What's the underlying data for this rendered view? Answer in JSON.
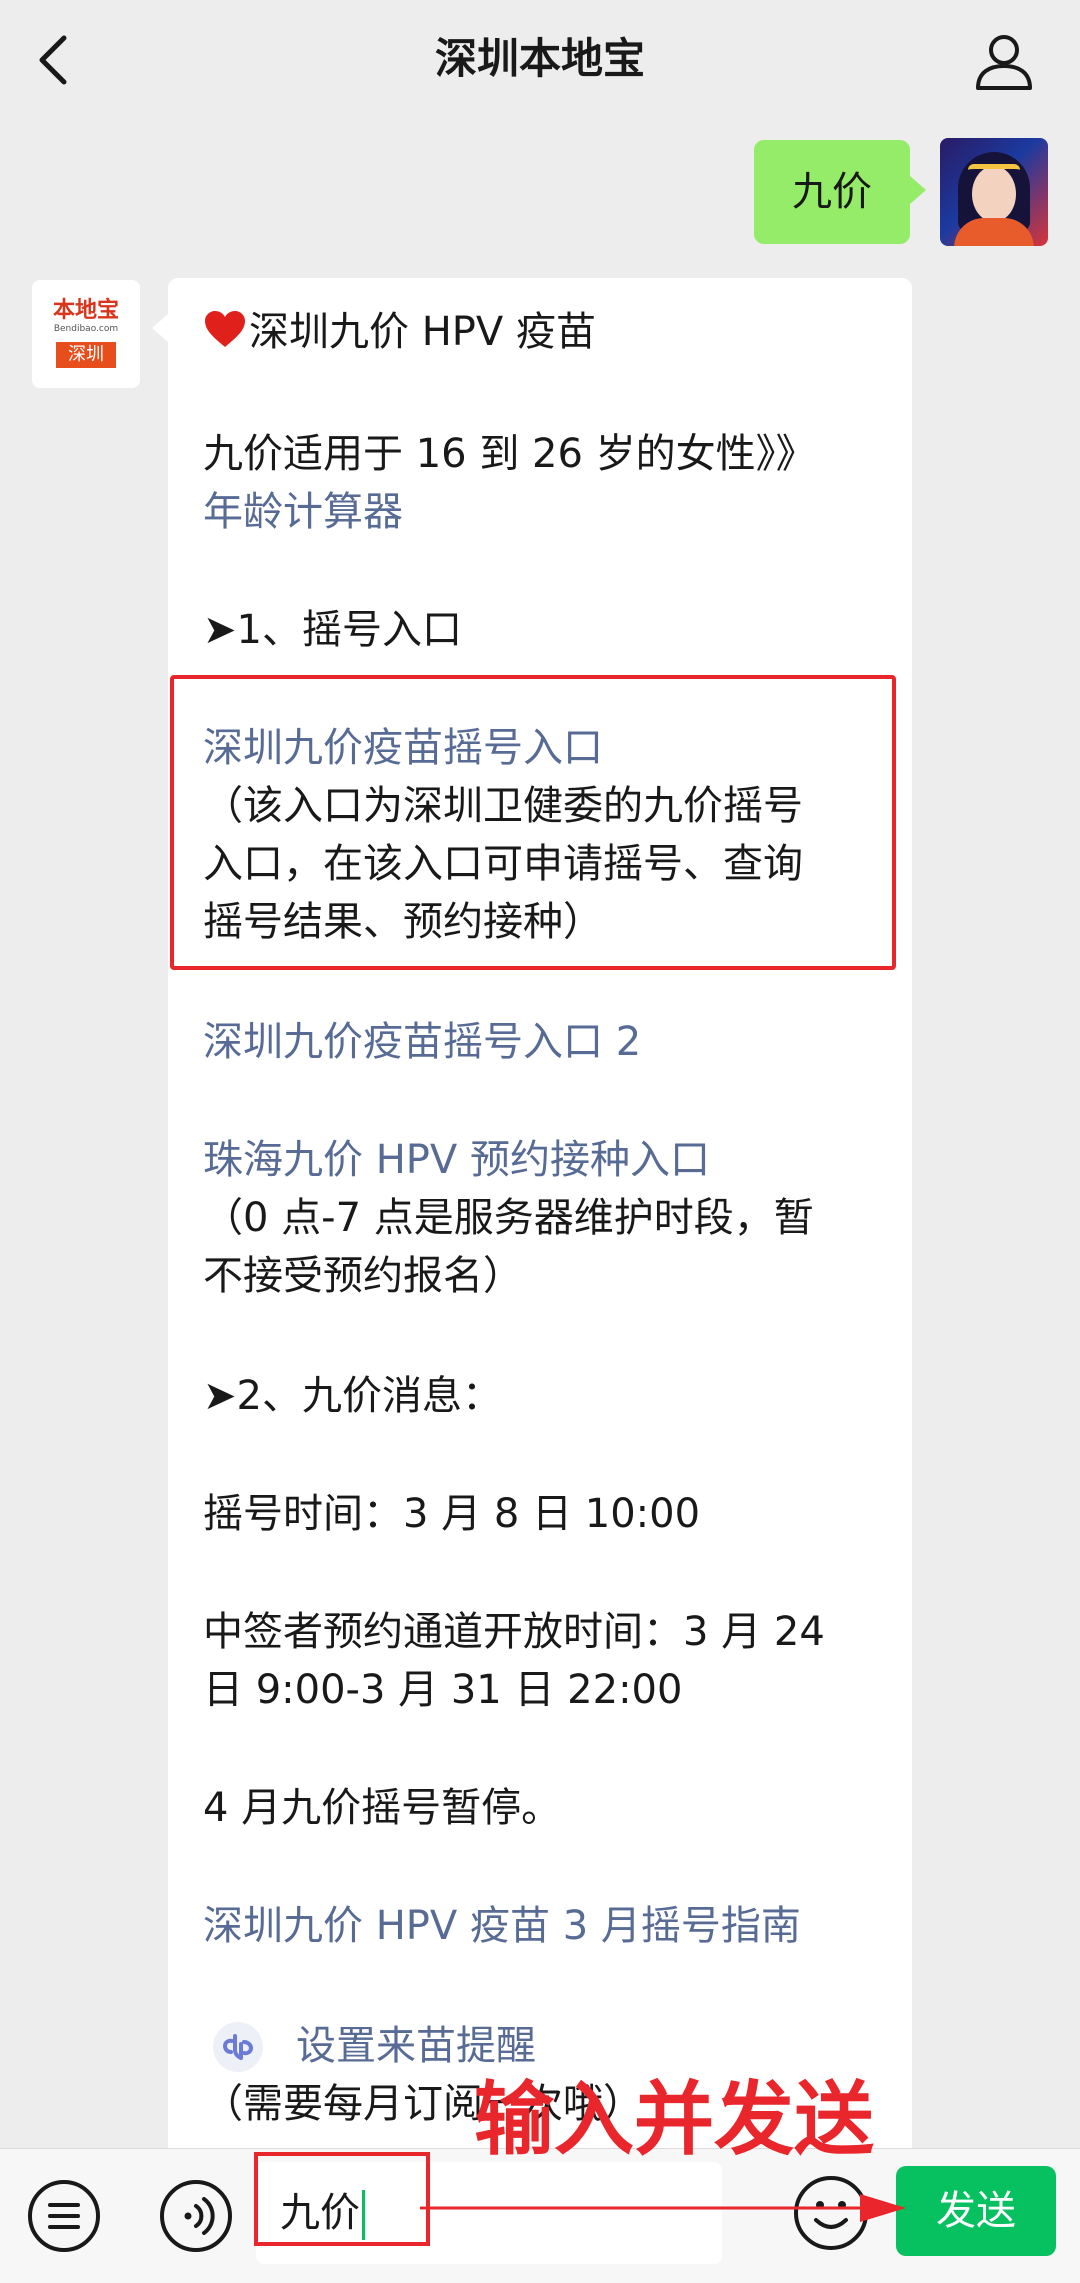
{
  "header": {
    "title": "深圳本地宝"
  },
  "user_message": {
    "text": "九价"
  },
  "bot_avatar": {
    "logo_text": "本地宝",
    "logo_sub": "Bendibao.com",
    "logo_city": "深圳"
  },
  "bot_message": {
    "title": "深圳九价 HPV 疫苗",
    "age_line": "九价适用于 16 到 26 岁的女性》》",
    "age_link": "年龄计算器",
    "section1": "➤1、摇号入口",
    "entry1_link": "深圳九价疫苗摇号入口",
    "entry1_desc1": "（该入口为深圳卫健委的九价摇号",
    "entry1_desc2": "入口，在该入口可申请摇号、查询",
    "entry1_desc3": "摇号结果、预约接种）",
    "entry2_link": "深圳九价疫苗摇号入口 2",
    "entry3_link": "珠海九价 HPV 预约接种入口",
    "entry3_desc1": "（0 点-7 点是服务器维护时段，暂",
    "entry3_desc2": "不接受预约报名）",
    "section2": "➤2、九价消息：",
    "lottery_time": "摇号时间：3 月 8 日 10:00",
    "booking_line1": "中签者预约通道开放时间：3 月 24",
    "booking_line2": "日 9:00-3 月 31 日 22:00",
    "april_note": "4 月九价摇号暂停。",
    "guide_link": "深圳九价 HPV 疫苗 3 月摇号指南",
    "reminder_link": "设置来苗提醒",
    "reminder_desc": "（需要每月订阅一次哦）"
  },
  "input": {
    "value": "九价"
  },
  "send_button": {
    "label": "发送"
  },
  "annotation": {
    "text": "输入并发送"
  },
  "colors": {
    "wechat_green": "#07c160",
    "bubble_green": "#95ec69",
    "link": "#576b95",
    "annotation_red": "#e8262c"
  }
}
